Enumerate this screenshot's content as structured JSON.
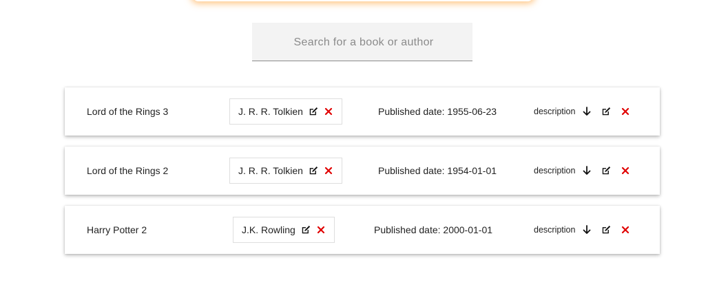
{
  "search": {
    "placeholder": "Search for a book or author"
  },
  "colors": {
    "accent_glow": "#ffa53c",
    "delete": "#e00000",
    "text": "#222222"
  },
  "books": [
    {
      "title": "Lord of the Rings 3",
      "author": "J. R. R. Tolkien",
      "published": "Published date: 1955-06-23",
      "description_label": "description"
    },
    {
      "title": "Lord of the Rings 2",
      "author": "J. R. R. Tolkien",
      "published": "Published date: 1954-01-01",
      "description_label": "description"
    },
    {
      "title": "Harry Potter 2",
      "author": "J.K. Rowling",
      "published": "Published date: 2000-01-01",
      "description_label": "description"
    }
  ]
}
